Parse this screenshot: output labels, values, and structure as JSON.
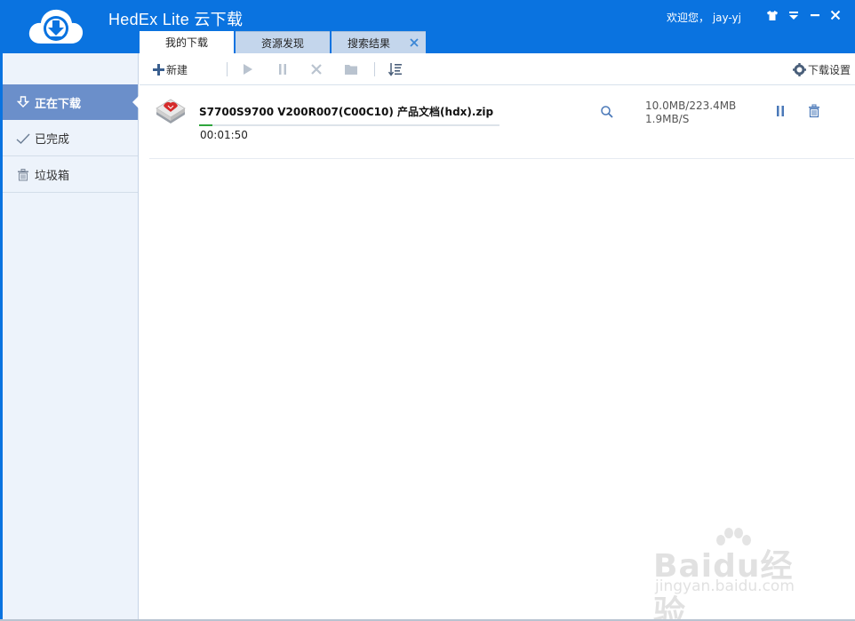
{
  "window": {
    "title": "HedEx Lite 云下载",
    "greeting": "欢迎您， jay-yj"
  },
  "tabs": [
    {
      "label": "我的下载",
      "active": true
    },
    {
      "label": "资源发现",
      "active": false
    },
    {
      "label": "搜索结果",
      "active": false,
      "closable": true
    }
  ],
  "sidebar": {
    "items": [
      {
        "label": "正在下载",
        "icon": "download-icon",
        "active": true
      },
      {
        "label": "已完成",
        "icon": "check-icon",
        "active": false
      },
      {
        "label": "垃圾箱",
        "icon": "trash-icon",
        "active": false
      }
    ]
  },
  "toolbar": {
    "new_label": "新建",
    "settings_label": "下载设置",
    "buttons": [
      "plus-icon",
      "play-icon",
      "pause-icon",
      "cancel-icon",
      "folder-icon",
      "sort-icon",
      "gear-icon"
    ]
  },
  "downloads": [
    {
      "name": "S7700S9700  V200R007(C00C10) 产品文档(hdx).zip",
      "elapsed": "00:01:50",
      "size": "10.0MB/223.4MB",
      "speed": "1.9MB/S",
      "progress": 0.045
    }
  ],
  "watermark": {
    "brand": "Baidu经验",
    "url": "jingyan.baidu.com"
  },
  "colors": {
    "titlebar": "#0a73e0",
    "sidebar_active": "#6b8fca",
    "progress": "#2fa53c",
    "icon_blue": "#4a78b8"
  }
}
